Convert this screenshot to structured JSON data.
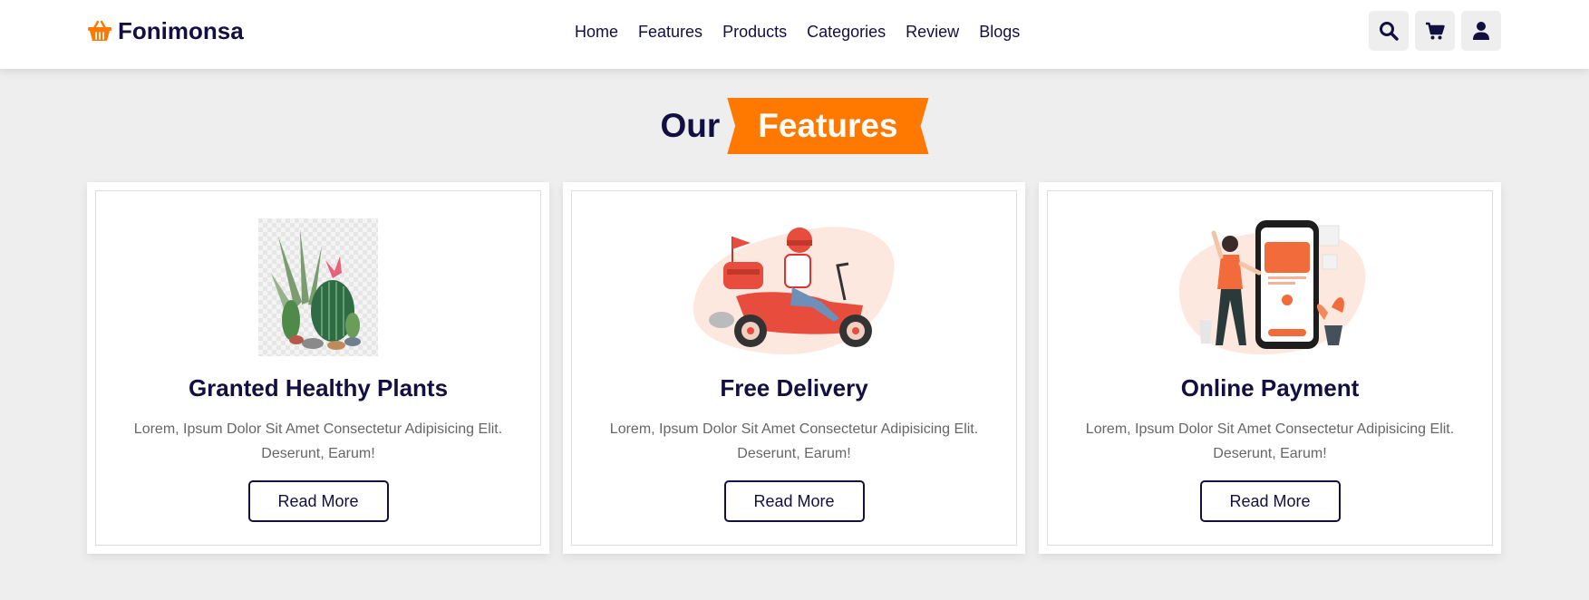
{
  "header": {
    "logo_text": "Fonimonsa",
    "logo_icon": "basket-icon",
    "nav": [
      {
        "label": "Home"
      },
      {
        "label": "Features"
      },
      {
        "label": "Products"
      },
      {
        "label": "Categories"
      },
      {
        "label": "Review"
      },
      {
        "label": "Blogs"
      }
    ],
    "icons": [
      "search-icon",
      "cart-icon",
      "user-icon"
    ]
  },
  "section": {
    "title_plain": "Our",
    "title_highlight": "Features"
  },
  "cards": [
    {
      "image": "cactus-plant-image",
      "title": "Granted Healthy Plants",
      "text": "Lorem, Ipsum Dolor Sit Amet Consectetur Adipisicing Elit. Deserunt, Earum!",
      "button": "Read More"
    },
    {
      "image": "delivery-scooter-image",
      "title": "Free Delivery",
      "text": "Lorem, Ipsum Dolor Sit Amet Consectetur Adipisicing Elit. Deserunt, Earum!",
      "button": "Read More"
    },
    {
      "image": "online-payment-image",
      "title": "Online Payment",
      "text": "Lorem, Ipsum Dolor Sit Amet Consectetur Adipisicing Elit. Deserunt, Earum!",
      "button": "Read More"
    }
  ],
  "colors": {
    "accent": "#ff7800",
    "text_dark": "#130f40",
    "background": "#eeeeee"
  }
}
